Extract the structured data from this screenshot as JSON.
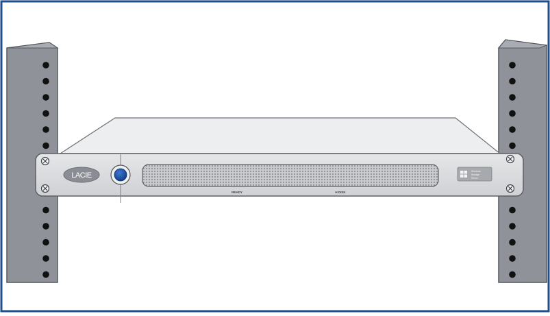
{
  "device": {
    "brand_logo": "LACIE",
    "indicators": [
      "READY",
      "H DISK"
    ],
    "os_badge": [
      "Windows",
      "Storage",
      "Server"
    ]
  },
  "colors": {
    "frame_border": "#1f4e8c",
    "rack_rail": "#8f9299",
    "rack_rail_shadow": "#6f727a",
    "device_face": "#d6d8db",
    "device_top": "#eceef0",
    "power_button": "#1f4fa0",
    "logo_badge": "#8a8d93"
  },
  "icons": [
    "mounting-screw-icon",
    "power-button-icon",
    "windows-logo-icon"
  ]
}
